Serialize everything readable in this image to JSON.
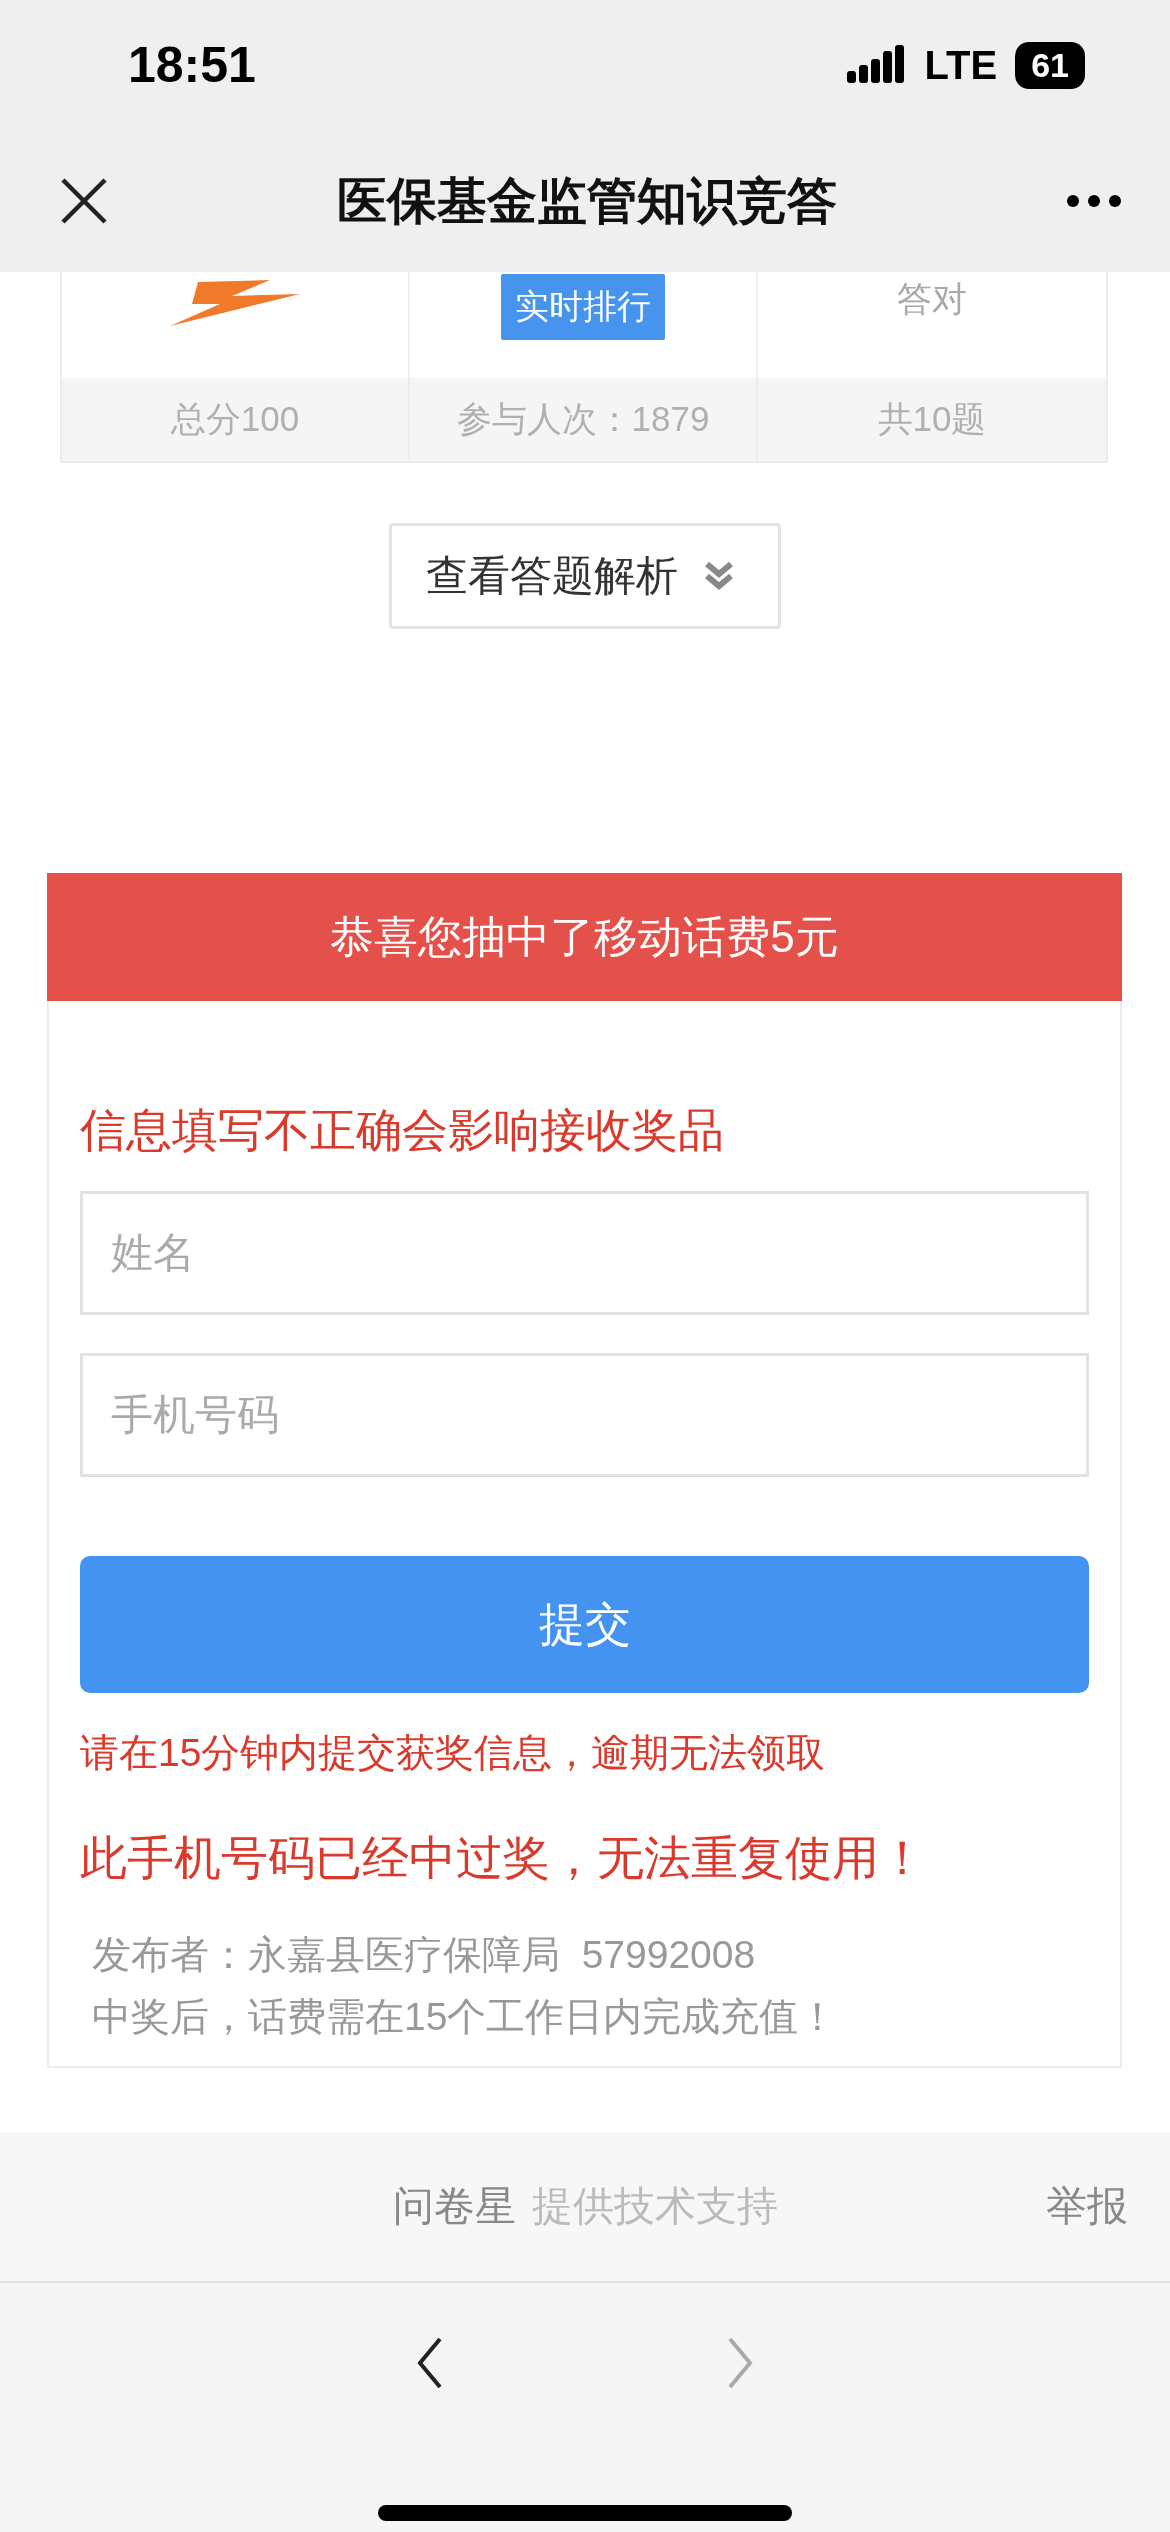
{
  "status_bar": {
    "time": "18:51",
    "network": "LTE",
    "battery": "61"
  },
  "nav": {
    "title": "医保基金监管知识竞答"
  },
  "score_table": {
    "cells": [
      {
        "kind": "logo"
      },
      {
        "kind": "button",
        "label": "实时排行"
      },
      {
        "kind": "text",
        "label": "答对"
      }
    ],
    "footer": [
      "总分100",
      "参与人次：1879",
      "共10题"
    ]
  },
  "analysis_button": {
    "label": "查看答题解析"
  },
  "prize": {
    "title": "恭喜您抽中了移动话费5元",
    "warning": "信息填写不正确会影响接收奖品",
    "fields": [
      {
        "placeholder": "姓名"
      },
      {
        "placeholder": "手机号码"
      }
    ],
    "submit": "提交",
    "notices": [
      {
        "kind": "small",
        "text": "请在15分钟内提交获奖信息，逾期无法领取"
      },
      {
        "kind": "large",
        "text": "此手机号码已经中过奖，无法重复使用！"
      }
    ],
    "info": [
      "发布者：永嘉县医疗保障局  57992008",
      "中奖后，话费需在15个工作日内完成充值！"
    ]
  },
  "footer": {
    "brand": "问卷星",
    "support": "提供技术支持",
    "report": "举报"
  },
  "toolbar": {
    "back": {
      "disabled": false
    },
    "forward": {
      "disabled": true
    }
  }
}
